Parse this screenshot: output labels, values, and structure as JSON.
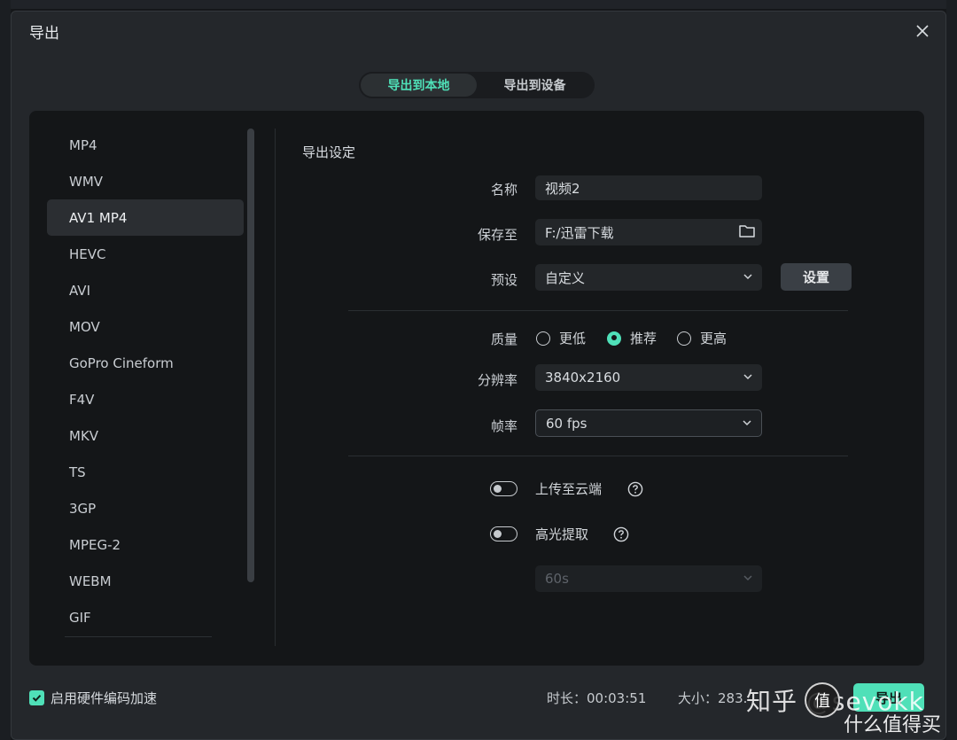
{
  "dialog": {
    "title": "导出"
  },
  "tabs": [
    {
      "label": "导出到本地",
      "active": true
    },
    {
      "label": "导出到设备",
      "active": false
    }
  ],
  "formats": [
    "MP4",
    "WMV",
    "AV1 MP4",
    "HEVC",
    "AVI",
    "MOV",
    "GoPro Cineform",
    "F4V",
    "MKV",
    "TS",
    "3GP",
    "MPEG-2",
    "WEBM",
    "GIF"
  ],
  "selected_format": "AV1 MP4",
  "settings": {
    "title": "导出设定",
    "name_label": "名称",
    "name_value": "视频2",
    "save_label": "保存至",
    "save_value": "F:/迅雷下载",
    "preset_label": "预设",
    "preset_value": "自定义",
    "preset_button": "设置",
    "quality_label": "质量",
    "quality_options": [
      {
        "label": "更低",
        "selected": false
      },
      {
        "label": "推荐",
        "selected": true
      },
      {
        "label": "更高",
        "selected": false
      }
    ],
    "resolution_label": "分辨率",
    "resolution_value": "3840x2160",
    "fps_label": "帧率",
    "fps_value": "60 fps",
    "upload_label": "上传至云端",
    "upload_on": false,
    "highlight_label": "高光提取",
    "highlight_on": false,
    "duration_select_value": "60s"
  },
  "footer": {
    "hw_accel_label": "启用硬件编码加速",
    "hw_accel_checked": true,
    "duration_text": "时长：00:03:51",
    "size_text": "大小：283.",
    "export_label": "导出"
  },
  "watermark": {
    "text": "知乎 @sevokk",
    "sub": "什么值得买",
    "badge": "值"
  },
  "colors": {
    "accent": "#4fe0b8",
    "panel": "#141618",
    "dialog": "#24272b"
  }
}
